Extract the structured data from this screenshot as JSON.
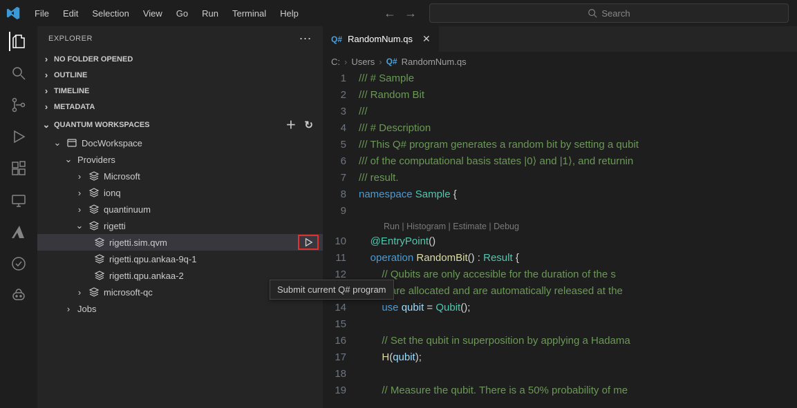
{
  "menubar": {
    "file": "File",
    "edit": "Edit",
    "selection": "Selection",
    "view": "View",
    "go": "Go",
    "run": "Run",
    "terminal": "Terminal",
    "help": "Help"
  },
  "search": {
    "placeholder": "Search"
  },
  "sidebar": {
    "title": "EXPLORER",
    "sections": {
      "no_folder": "NO FOLDER OPENED",
      "outline": "OUTLINE",
      "timeline": "TIMELINE",
      "metadata": "METADATA",
      "quantum": "QUANTUM WORKSPACES"
    },
    "workspace": {
      "name": "DocWorkspace",
      "providers_label": "Providers",
      "jobs_label": "Jobs",
      "providers": [
        {
          "name": "Microsoft",
          "expanded": false
        },
        {
          "name": "ionq",
          "expanded": false
        },
        {
          "name": "quantinuum",
          "expanded": false
        },
        {
          "name": "rigetti",
          "expanded": true,
          "targets": [
            {
              "name": "rigetti.sim.qvm",
              "selected": true,
              "showPlay": true
            },
            {
              "name": "rigetti.qpu.ankaa-9q-1"
            },
            {
              "name": "rigetti.qpu.ankaa-2"
            }
          ]
        },
        {
          "name": "microsoft-qc",
          "expanded": false
        }
      ]
    },
    "tooltip": "Submit current Q# program"
  },
  "tab": {
    "lang": "Q#",
    "filename": "RandomNum.qs"
  },
  "breadcrumb": {
    "root": "C:",
    "users": "Users",
    "lang": "Q#",
    "file": "RandomNum.qs"
  },
  "codelens": "Run | Histogram | Estimate | Debug",
  "code": [
    {
      "n": 1,
      "t": [
        "doc",
        "/// # Sample"
      ]
    },
    {
      "n": 2,
      "t": [
        "doc",
        "/// Random Bit"
      ]
    },
    {
      "n": 3,
      "t": [
        "doc",
        "///"
      ]
    },
    {
      "n": 4,
      "t": [
        "doc",
        "/// # Description"
      ]
    },
    {
      "n": 5,
      "t": [
        "doc",
        "/// This Q# program generates a random bit by setting a qubit "
      ]
    },
    {
      "n": 6,
      "t": [
        "doc",
        "/// of the computational basis states |0⟩ and |1⟩, and returnin"
      ]
    },
    {
      "n": 7,
      "t": [
        "doc",
        "/// result."
      ]
    },
    {
      "n": 8,
      "html": "<span class='tok-kw'>namespace</span> <span class='tok-type'>Sample</span> <span class='tok-punct'>{</span>"
    },
    {
      "n": 9,
      "html": ""
    },
    {
      "n": 10,
      "html": "    <span class='tok-attr'>@EntryPoint</span><span class='tok-punct'>()</span>",
      "lens": true
    },
    {
      "n": 11,
      "html": "    <span class='tok-kw'>operation</span> <span class='tok-fn'>RandomBit</span><span class='tok-punct'>()</span> <span class='tok-punct'>:</span> <span class='tok-type'>Result</span> <span class='tok-punct'>{</span>"
    },
    {
      "n": 12,
      "html": "        <span class='tok-doc'>// Qubits are only accesible for the duration of the s</span>"
    },
    {
      "n": 13,
      "html": "        <span class='tok-doc'>// are allocated and are automatically released at the</span>"
    },
    {
      "n": 14,
      "html": "        <span class='tok-kw'>use</span> <span class='tok-var'>qubit</span> <span class='tok-punct'>=</span> <span class='tok-type'>Qubit</span><span class='tok-punct'>();</span>"
    },
    {
      "n": 15,
      "html": ""
    },
    {
      "n": 16,
      "html": "        <span class='tok-doc'>// Set the qubit in superposition by applying a Hadama</span>"
    },
    {
      "n": 17,
      "html": "        <span class='tok-fn'>H</span><span class='tok-punct'>(</span><span class='tok-var'>qubit</span><span class='tok-punct'>);</span>"
    },
    {
      "n": 18,
      "html": ""
    },
    {
      "n": 19,
      "html": "        <span class='tok-doc'>// Measure the qubit. There is a 50% probability of me</span>"
    }
  ]
}
